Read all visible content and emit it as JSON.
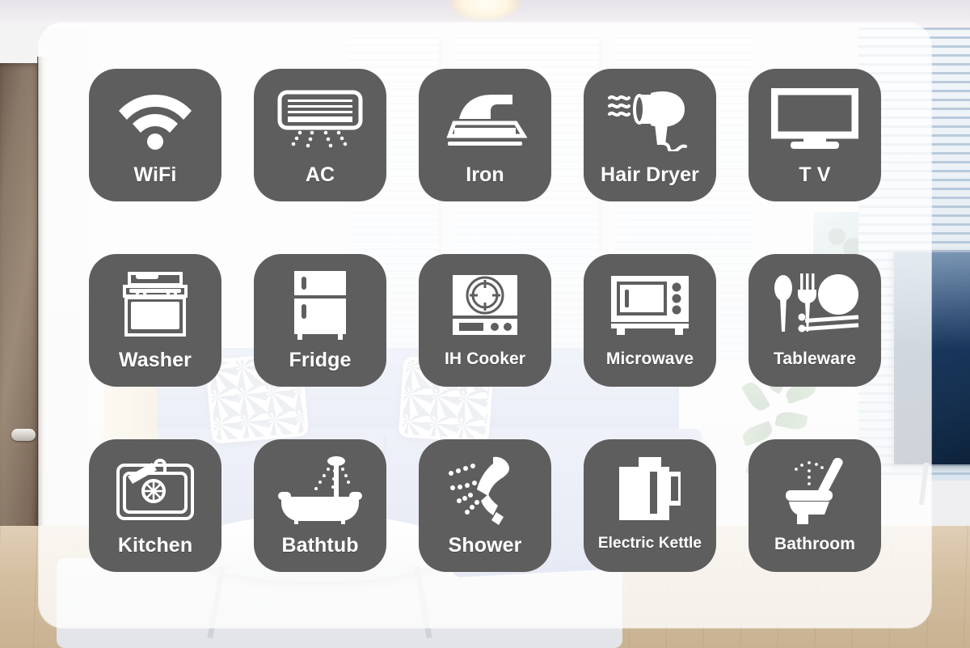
{
  "scene": {
    "description": "Japanese apartment amenities icon board overlaid on a living-room photo",
    "background_name": "living-room-photo",
    "overlay_color": "#ffffff",
    "tile_color": "#5e5e5e",
    "tile_icon_color": "#ffffff",
    "sofa_color": "#9dacd6",
    "floor_color": "#d4bfa1",
    "door_color": "#8a7868"
  },
  "grid": {
    "columns": 5,
    "rows": 3,
    "items": [
      {
        "id": "wifi",
        "label": "WiFi",
        "icon": "wifi-icon",
        "size": "normal"
      },
      {
        "id": "ac",
        "label": "AC",
        "icon": "air-conditioner-icon",
        "size": "normal"
      },
      {
        "id": "iron",
        "label": "Iron",
        "icon": "iron-icon",
        "size": "normal"
      },
      {
        "id": "hair-dryer",
        "label": "Hair Dryer",
        "icon": "hair-dryer-icon",
        "size": "normal"
      },
      {
        "id": "tv",
        "label": "T V",
        "icon": "television-icon",
        "size": "normal"
      },
      {
        "id": "washer",
        "label": "Washer",
        "icon": "washing-machine-icon",
        "size": "normal"
      },
      {
        "id": "fridge",
        "label": "Fridge",
        "icon": "refrigerator-icon",
        "size": "normal"
      },
      {
        "id": "ih-cooker",
        "label": "IH Cooker",
        "icon": "induction-cooker-icon",
        "size": "small"
      },
      {
        "id": "microwave",
        "label": "Microwave",
        "icon": "microwave-icon",
        "size": "small"
      },
      {
        "id": "tableware",
        "label": "Tableware",
        "icon": "tableware-icon",
        "size": "small"
      },
      {
        "id": "kitchen",
        "label": "Kitchen",
        "icon": "kitchen-sink-icon",
        "size": "normal"
      },
      {
        "id": "bathtub",
        "label": "Bathtub",
        "icon": "bathtub-icon",
        "size": "normal"
      },
      {
        "id": "shower",
        "label": "Shower",
        "icon": "shower-head-icon",
        "size": "normal"
      },
      {
        "id": "electric-kettle",
        "label": "Electric Kettle",
        "icon": "electric-kettle-icon",
        "size": "xsmall"
      },
      {
        "id": "bathroom",
        "label": "Bathroom",
        "icon": "toilet-icon",
        "size": "small"
      }
    ]
  }
}
